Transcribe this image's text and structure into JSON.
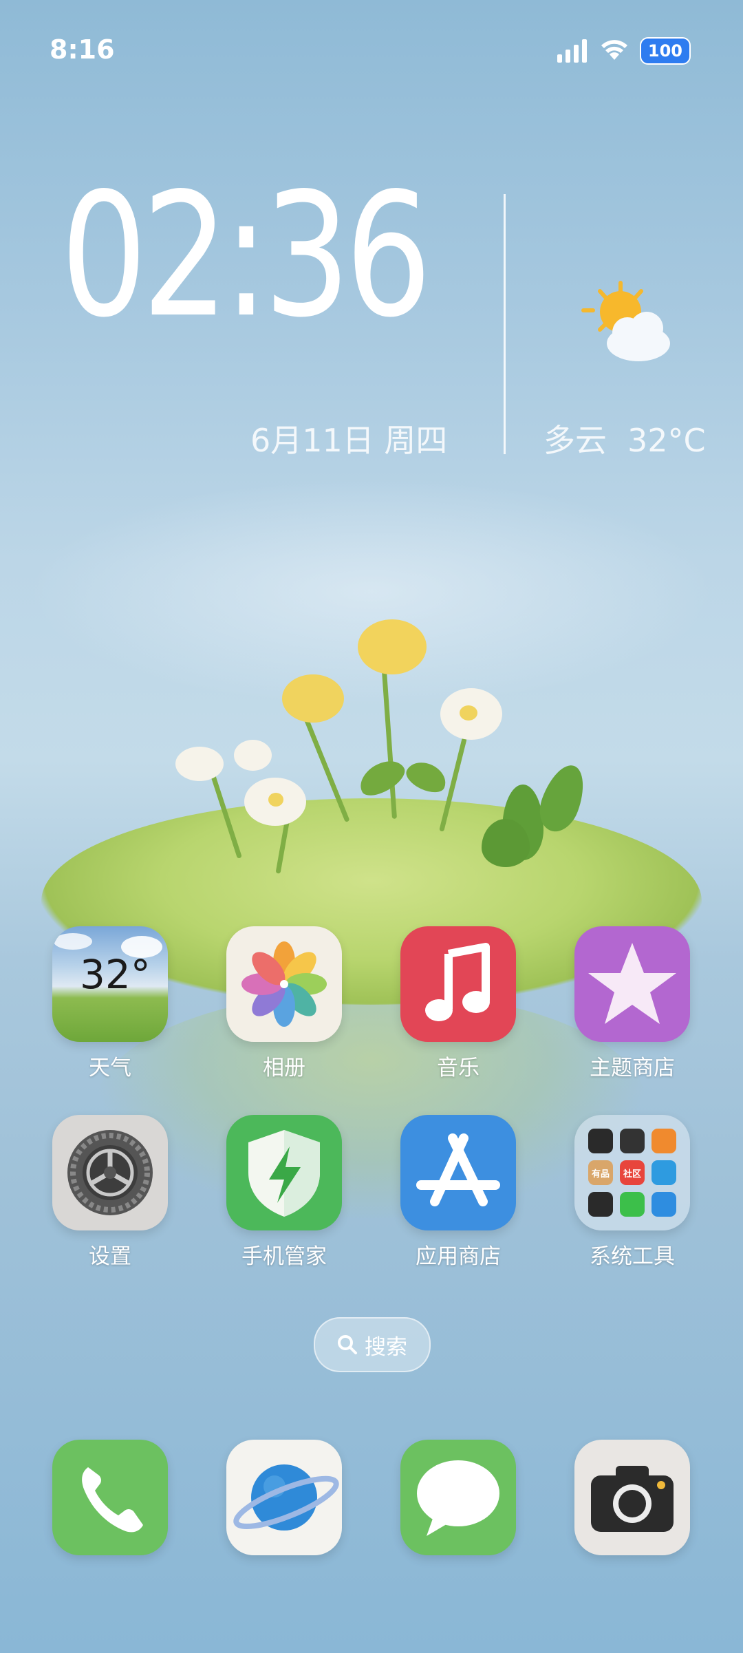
{
  "status_bar": {
    "time": "8:16",
    "battery": "100",
    "icons": [
      "signal-icon",
      "wifi-icon",
      "battery-icon"
    ]
  },
  "clock_widget": {
    "time": "02:36",
    "date": "6月11日 周四",
    "weather_condition": "多云",
    "temperature": "32°C",
    "weather_icon": "partly-cloudy-icon"
  },
  "apps": [
    {
      "label": "天气",
      "icon": "weather-icon",
      "badge_text": "32°"
    },
    {
      "label": "相册",
      "icon": "photos-icon"
    },
    {
      "label": "音乐",
      "icon": "music-note-icon"
    },
    {
      "label": "主题商店",
      "icon": "star-icon"
    },
    {
      "label": "设置",
      "icon": "gear-icon"
    },
    {
      "label": "手机管家",
      "icon": "shield-bolt-icon"
    },
    {
      "label": "应用商店",
      "icon": "app-store-icon"
    },
    {
      "label": "系统工具",
      "icon": "folder-icon",
      "folder_items": [
        "有品",
        "社区"
      ]
    }
  ],
  "search": {
    "label": "搜索",
    "icon": "search-icon"
  },
  "dock": [
    {
      "name": "phone",
      "icon": "phone-icon"
    },
    {
      "name": "browser",
      "icon": "planet-icon"
    },
    {
      "name": "messages",
      "icon": "message-bubble-icon"
    },
    {
      "name": "camera",
      "icon": "camera-icon"
    }
  ],
  "colors": {
    "music": "#e24656",
    "theme": "#b367d0",
    "guard": "#4cb85a",
    "store": "#3d8fe0",
    "dock_green": "#6cc160"
  }
}
